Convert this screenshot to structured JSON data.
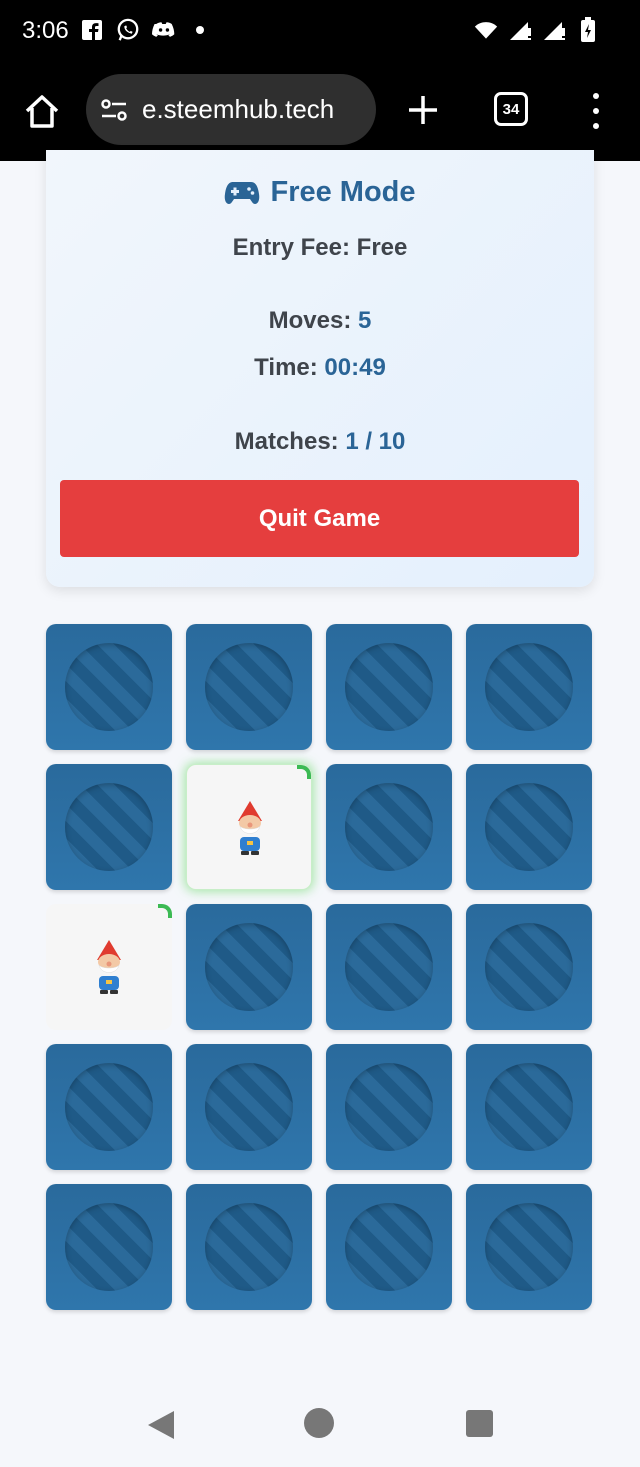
{
  "status_bar": {
    "time": "3:06",
    "icons_left": [
      "facebook-icon",
      "whatsapp-icon",
      "discord-icon",
      "dot-icon"
    ],
    "icons_right": [
      "wifi-icon",
      "signal-icon",
      "signal-icon",
      "battery-icon"
    ]
  },
  "browser": {
    "url": "e.steemhub.tech",
    "tab_count": "34"
  },
  "game": {
    "mode_title": "Free Mode",
    "entry_fee_label": "Entry Fee:",
    "entry_fee_value": "Free",
    "moves_label": "Moves:",
    "moves_value": "5",
    "time_label": "Time:",
    "time_value": "00:49",
    "matches_label": "Matches:",
    "matches_value": "1 / 10",
    "quit_label": "Quit Game",
    "accent_color": "#2a6496",
    "quit_color": "#e53e3e"
  },
  "board": {
    "columns": 4,
    "rows": 5,
    "cards": [
      {
        "state": "hidden"
      },
      {
        "state": "hidden"
      },
      {
        "state": "hidden"
      },
      {
        "state": "hidden"
      },
      {
        "state": "hidden"
      },
      {
        "state": "revealed",
        "icon": "gnome-icon",
        "highlight": true
      },
      {
        "state": "hidden"
      },
      {
        "state": "hidden"
      },
      {
        "state": "revealed",
        "icon": "gnome-icon",
        "highlight": false
      },
      {
        "state": "hidden"
      },
      {
        "state": "hidden"
      },
      {
        "state": "hidden"
      },
      {
        "state": "hidden"
      },
      {
        "state": "hidden"
      },
      {
        "state": "hidden"
      },
      {
        "state": "hidden"
      },
      {
        "state": "hidden"
      },
      {
        "state": "hidden"
      },
      {
        "state": "hidden"
      },
      {
        "state": "hidden"
      }
    ]
  }
}
